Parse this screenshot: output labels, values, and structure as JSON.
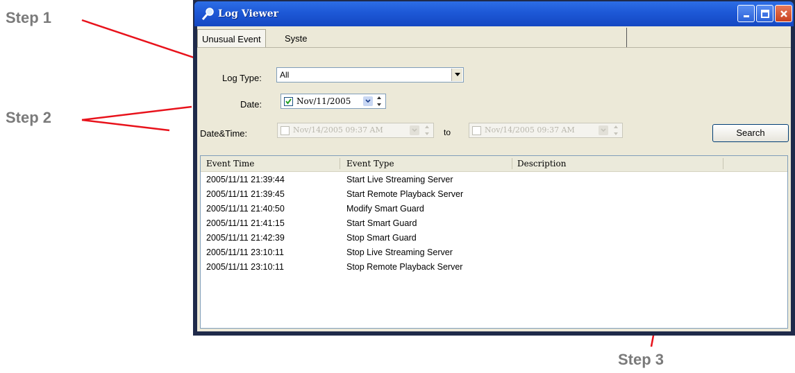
{
  "annotations": {
    "step1": "Step 1",
    "step2": "Step 2",
    "step3": "Step 3",
    "color": "#e8121b"
  },
  "window": {
    "title": "Log Viewer",
    "icon": "magnifier-icon"
  },
  "tabs": [
    {
      "label": "Unusual Event",
      "active": true
    },
    {
      "label": "Syste",
      "active": false
    }
  ],
  "filters": {
    "log_type_label": "Log Type:",
    "log_type_value": "All",
    "date_label": "Date:",
    "date_value": "Nov/11/2005",
    "date_checked": true,
    "datetime_label": "Date&Time:",
    "datetime_from": "Nov/14/2005 09:37 AM",
    "to_label": "to",
    "datetime_to": "Nov/14/2005 09:37 AM",
    "datetime_checked": false,
    "search_label": "Search"
  },
  "list": {
    "columns": [
      "Event Time",
      "Event Type",
      "Description"
    ],
    "rows": [
      [
        "2005/11/11 21:39:44",
        "Start Live Streaming Server",
        ""
      ],
      [
        "2005/11/11 21:39:45",
        "Start Remote Playback Server",
        ""
      ],
      [
        "2005/11/11 21:40:50",
        "Modify Smart Guard",
        ""
      ],
      [
        "2005/11/11 21:41:15",
        "Start Smart Guard",
        ""
      ],
      [
        "2005/11/11 21:42:39",
        "Stop Smart Guard",
        ""
      ],
      [
        "2005/11/11 23:10:11",
        "Stop Live Streaming Server",
        ""
      ],
      [
        "2005/11/11 23:10:11",
        "Stop Remote Playback Server",
        ""
      ]
    ]
  }
}
